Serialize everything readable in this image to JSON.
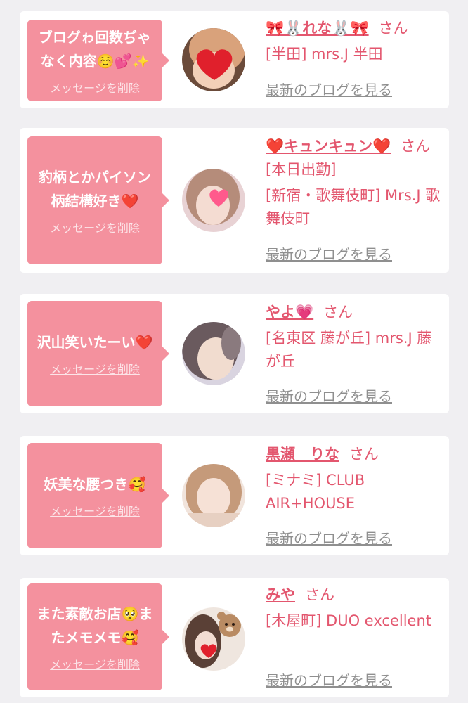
{
  "cards": [
    {
      "message": "ブログゎ回数ぢゃなく内容☺️💕✨",
      "delete_label": "メッセージを削除",
      "name": "🎀🐰れな🐰🎀",
      "honorific": "さん",
      "shop": "[半田] mrs.J 半田",
      "blog_link": "最新のブログを見る",
      "avatar": "heart-emoji-photo"
    },
    {
      "message": "豹柄とかパイソン柄結構好き❤️",
      "delete_label": "メッセージを削除",
      "name": "❤️キュンキュン❤️",
      "honorific": "さん[本日出勤]",
      "shop": "[新宿・歌舞伎町] Mrs.J 歌舞伎町",
      "blog_link": "最新のブログを見る",
      "avatar": "heart-emoji-photo"
    },
    {
      "message": "沢山笑いたーい❤️",
      "delete_label": "メッセージを削除",
      "name": "やよ💗",
      "honorific": "さん",
      "shop": "[名東区 藤が丘] mrs.J 藤が丘",
      "blog_link": "最新のブログを見る",
      "avatar": "portrait-photo"
    },
    {
      "message": "妖美な腰つき🥰",
      "delete_label": "メッセージを削除",
      "name": "黒瀬　りな",
      "honorific": "さん",
      "shop": "[ミナミ] CLUB AIR+HOUSE",
      "blog_link": "最新のブログを見る",
      "avatar": "portrait-photo"
    },
    {
      "message": "また素敵お店🥺またメモメモ🥰",
      "delete_label": "メッセージを削除",
      "name": "みや",
      "honorific": "さん",
      "shop": "[木屋町] DUO excellent",
      "blog_link": "最新のブログを見る",
      "avatar": "bear-sticker-photo"
    }
  ],
  "colors": {
    "accent": "#e3566e",
    "bubble": "#f4919e",
    "background": "#f0eff2",
    "link_gray": "#8f8f8f"
  }
}
